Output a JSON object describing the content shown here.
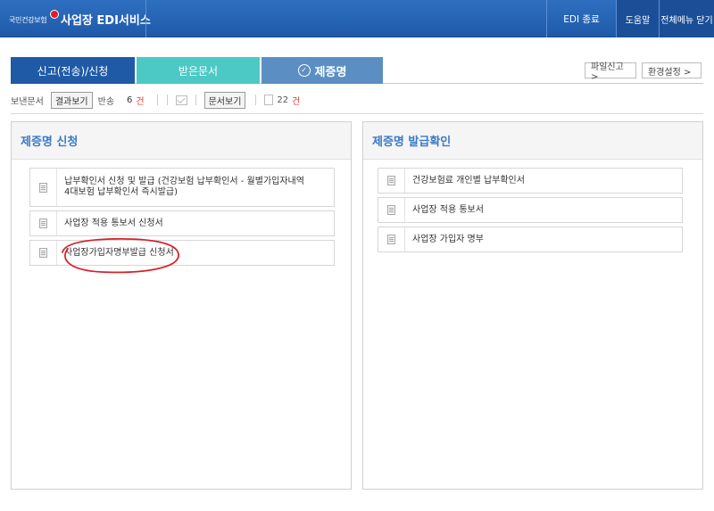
{
  "header": {
    "logo_text": "국민건강보험",
    "app_title": "사업장 EDI서비스",
    "edi_exit": "EDI 종료",
    "help": "도움말",
    "close_all_menus": "전체메뉴 닫기"
  },
  "tabs": [
    {
      "label": "신고(전송)/신청"
    },
    {
      "label": "받은문서"
    },
    {
      "label": "제증명",
      "selected": true
    }
  ],
  "top_buttons": {
    "file_report": "파일신고 >",
    "env_settings": "환경설정 >"
  },
  "toolbar": {
    "sent_docs_label": "보낸문서",
    "view_results": "결과보기",
    "returned_label": "반송",
    "returned_count": "6",
    "count_unit": "건",
    "view_docs": "문서보기",
    "docs_count": "22",
    "docs_unit": "건"
  },
  "left_panel": {
    "title": "제증명 신청",
    "items": [
      {
        "line1": "납부확인서 신청 및 발급 (건강보험 납부확인서 - 월별가입자내역",
        "line2": "4대보험 납부확인서 즉시발급)"
      },
      {
        "line1": "사업장 적용 통보서 신청서"
      },
      {
        "line1": "사업장가입자명부발급 신청서"
      }
    ]
  },
  "right_panel": {
    "title": "제증명 발급확인",
    "items": [
      {
        "line1": "건강보험료 개인별 납부확인서"
      },
      {
        "line1": "사업장 적용 통보서"
      },
      {
        "line1": "사업장 가입자 명부"
      }
    ]
  },
  "colors": {
    "header_blue": "#2466b5",
    "tab1": "#1f5aa6",
    "tab2": "#4cc9c5",
    "tab3": "#5b8fc4",
    "panel_title": "#3a7bc8",
    "annotation": "#d8212a"
  }
}
